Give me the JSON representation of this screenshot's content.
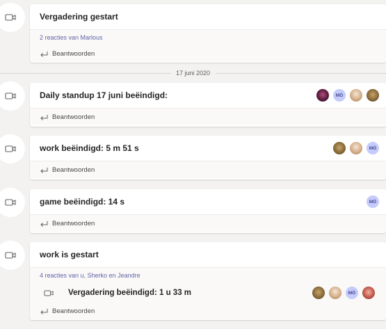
{
  "colors": {
    "accent": "#6264a7",
    "background": "#f3f2f1",
    "card": "#ffffff",
    "footer": "#faf9f8"
  },
  "icons": {
    "meeting": "video-camera-icon",
    "reply": "reply-arrow-icon"
  },
  "date_separator": "17 juni 2020",
  "posts": [
    {
      "title": "Vergadering gestart",
      "reactions": "2 reacties van Marlous",
      "reply_label": "Beantwoorden",
      "avatars": []
    },
    {
      "title": "Daily standup 17 juni beëindigd:",
      "reply_label": "Beantwoorden",
      "avatars": [
        "photo",
        "MÖ",
        "photo",
        "photo"
      ]
    },
    {
      "title": "work beëindigd: 5 m 51 s",
      "reply_label": "Beantwoorden",
      "avatars": [
        "photo",
        "photo",
        "MÖ"
      ]
    },
    {
      "title": "game beëindigd: 14 s",
      "reply_label": "Beantwoorden",
      "avatars": [
        "MÖ"
      ]
    },
    {
      "title": "work is gestart",
      "reactions": "4 reacties van u, Sherko en Jeandre",
      "nested_title": "Vergadering beëindigd: 1 u 33 m",
      "reply_label": "Beantwoorden",
      "avatars": [
        "photo",
        "photo",
        "MÖ",
        "photo"
      ]
    }
  ]
}
